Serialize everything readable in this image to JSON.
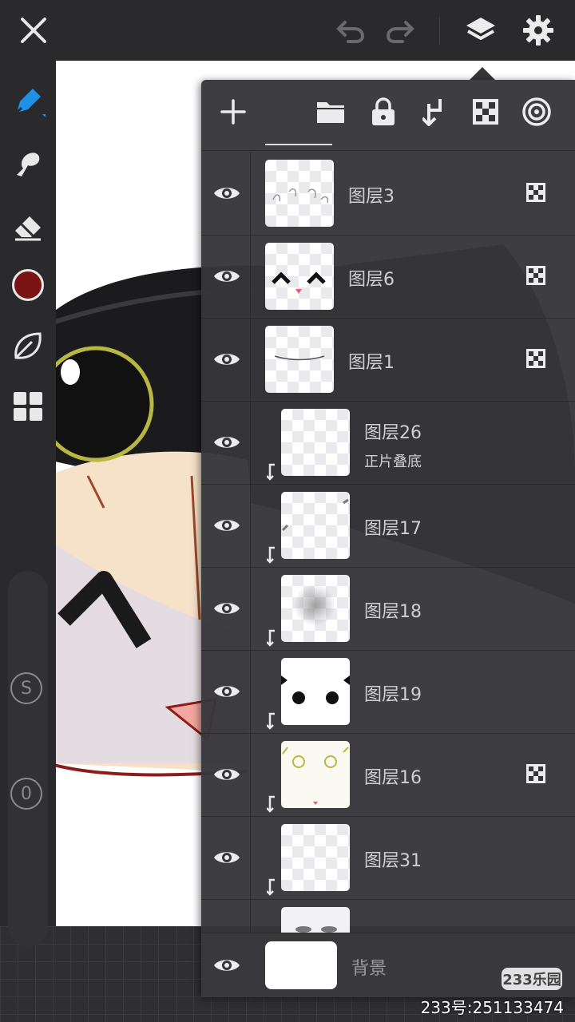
{
  "toolbar": {
    "icons": [
      "close-icon",
      "undo-icon",
      "redo-icon",
      "layers-icon",
      "gear-icon"
    ]
  },
  "tools": {
    "brush_color": "#7a1414",
    "icons": [
      "pen-icon",
      "smudge-icon",
      "eraser-icon",
      "color-swatch",
      "leaf-icon",
      "grid-icon"
    ],
    "size_label": "S",
    "opacity_label": "0"
  },
  "layers_panel": {
    "tool_icons": [
      "add-layer-icon",
      "folder-icon",
      "lock-icon",
      "merge-down-icon",
      "alpha-icon",
      "target-icon"
    ],
    "layers": [
      {
        "name": "图层3",
        "mode": "",
        "clipped": false,
        "alpha_lock": true
      },
      {
        "name": "图层6",
        "mode": "",
        "clipped": false,
        "alpha_lock": true
      },
      {
        "name": "图层1",
        "mode": "",
        "clipped": false,
        "alpha_lock": true
      },
      {
        "name": "图层26",
        "mode": "正片叠底",
        "clipped": true,
        "alpha_lock": false
      },
      {
        "name": "图层17",
        "mode": "",
        "clipped": true,
        "alpha_lock": false
      },
      {
        "name": "图层18",
        "mode": "",
        "clipped": true,
        "alpha_lock": false
      },
      {
        "name": "图层19",
        "mode": "",
        "clipped": true,
        "alpha_lock": false
      },
      {
        "name": "图层16",
        "mode": "",
        "clipped": true,
        "alpha_lock": true
      },
      {
        "name": "图层31",
        "mode": "",
        "clipped": true,
        "alpha_lock": false
      }
    ],
    "background_label": "背景"
  },
  "watermark": {
    "badge": "233乐园",
    "id_text": "233号:251133474"
  }
}
